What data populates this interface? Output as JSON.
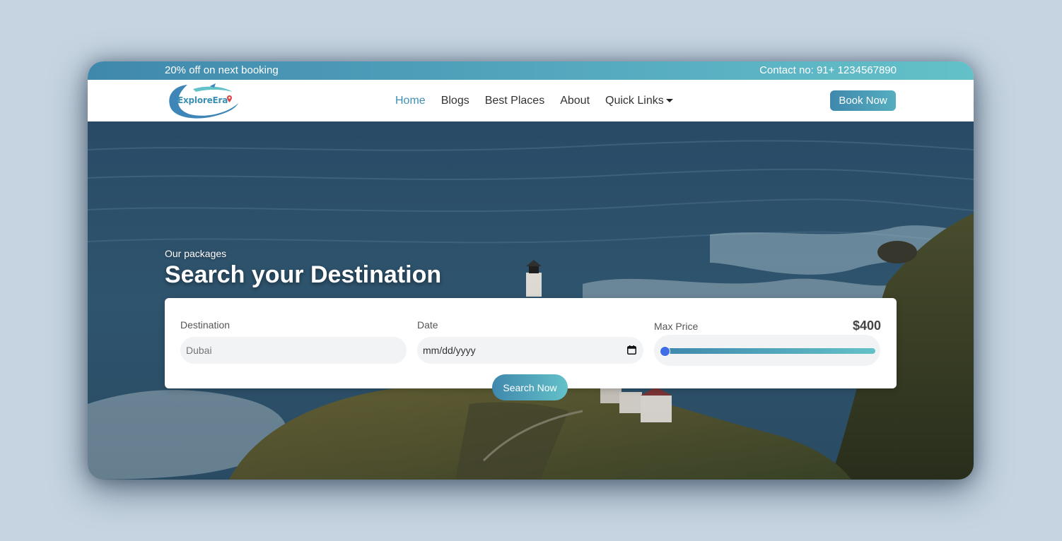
{
  "topbar": {
    "promo": "20% off on next booking",
    "contact": "Contact no: 91+ 1234567890"
  },
  "brand": {
    "logo_text": "ExploreEra"
  },
  "nav": {
    "items": [
      {
        "label": "Home",
        "active": true
      },
      {
        "label": "Blogs",
        "active": false
      },
      {
        "label": "Best Places",
        "active": false
      },
      {
        "label": "About",
        "active": false
      },
      {
        "label": "Quick Links",
        "active": false,
        "has_dropdown": true
      }
    ],
    "book_button": "Book Now"
  },
  "hero": {
    "kicker": "Our packages",
    "title": "Search your Destination"
  },
  "search": {
    "destination_label": "Destination",
    "destination_placeholder": "Dubai",
    "date_label": "Date",
    "date_placeholder": "mm/dd/yyyy",
    "price_label": "Max Price",
    "price_value": "$400",
    "price_slider_fraction": 0.0,
    "button_label": "Search Now"
  },
  "icons": {
    "calendar": "calendar-icon",
    "dropdown": "caret-down-icon",
    "location_pin": "map-pin-icon"
  },
  "colors": {
    "brand_gradient_start": "#3f88ad",
    "brand_gradient_end": "#63c1c8",
    "nav_active": "#3f8fb5",
    "slider_thumb": "#3f6de6"
  }
}
